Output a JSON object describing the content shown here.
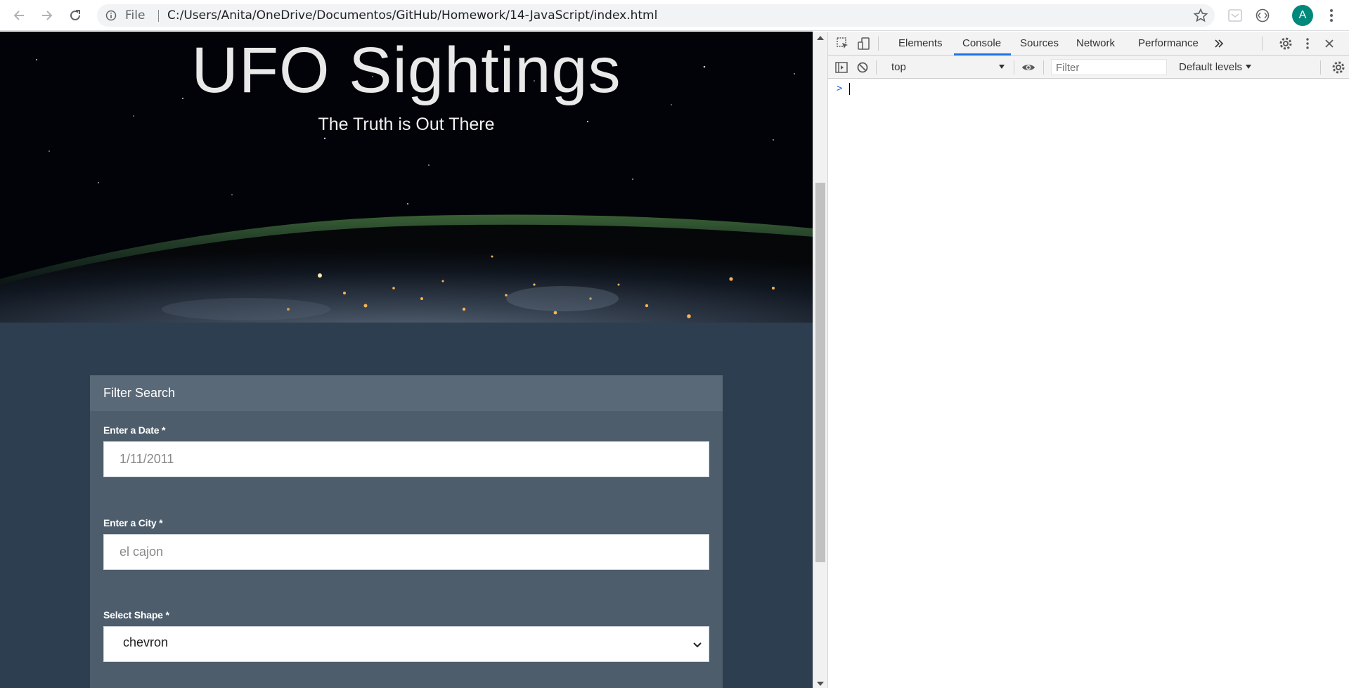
{
  "browser": {
    "omnibox_scheme": "File",
    "url": "C:/Users/Anita/OneDrive/Documentos/GitHub/Homework/14-JavaScript/index.html",
    "avatar_letter": "A",
    "icons": [
      "back-icon",
      "forward-icon",
      "reload-icon",
      "info-icon",
      "star-icon",
      "extension-icon",
      "devtools-extension-icon",
      "more-menu-icon"
    ]
  },
  "page": {
    "hero": {
      "title": "UFO Sightings",
      "subtitle": "The Truth is Out There"
    },
    "filter_panel": {
      "heading": "Filter Search",
      "date_label": "Enter a Date *",
      "date_placeholder": "1/11/2011",
      "city_label": "Enter a City *",
      "city_placeholder": "el cajon",
      "shape_label": "Select Shape *",
      "shape_selected": "chevron"
    },
    "colors": {
      "content_bg": "#2d3e50",
      "panel_bg": "#4e5d6c",
      "panel_header_bg": "#5a6978"
    }
  },
  "devtools": {
    "tabs": [
      "Elements",
      "Console",
      "Sources",
      "Network",
      "Performance"
    ],
    "active_tab": "Console",
    "context": "top",
    "filter_placeholder": "Filter",
    "levels": "Default levels",
    "prompt_symbol": ">",
    "accent": "#1a73e8"
  }
}
